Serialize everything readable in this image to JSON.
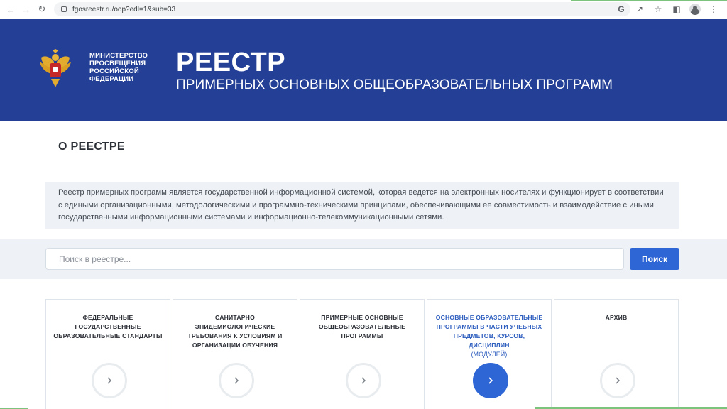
{
  "browser": {
    "url": "fgosreestr.ru/oop?edl=1&sub=33"
  },
  "header": {
    "ministry_lines": [
      "МИНИСТЕРСТВО",
      "ПРОСВЕЩЕНИЯ",
      "РОССИЙСКОЙ",
      "ФЕДЕРАЦИИ"
    ],
    "title": "РЕЕСТР",
    "subtitle": "ПРИМЕРНЫХ ОСНОВНЫХ ОБЩЕОБРАЗОВАТЕЛЬНЫХ ПРОГРАММ"
  },
  "about": {
    "title": "О РЕЕСТРЕ",
    "text": "Реестр примерных программ является государственной информационной системой, которая ведется на электронных носителях и функционирует в соответствии с едиными организационными, методологическими и программно-техническими принципами, обеспечивающими ее совместимость и взаимодействие с иными государственными информационными системами и информационно-телекоммуникационными сетями."
  },
  "search": {
    "placeholder": "Поиск в реестре...",
    "button_label": "Поиск"
  },
  "cards": [
    {
      "title": "ФЕДЕРАЛЬНЫЕ ГОСУДАРСТВЕННЫЕ ОБРАЗОВАТЕЛЬНЫЕ СТАНДАРТЫ",
      "sub": ""
    },
    {
      "title": "САНИТАРНО ЭПИДЕМИОЛОГИЧЕСКИЕ ТРЕБОВАНИЯ К УСЛОВИЯМ И ОРГАНИЗАЦИИ ОБУЧЕНИЯ",
      "sub": ""
    },
    {
      "title": "ПРИМЕРНЫЕ ОСНОВНЫЕ ОБЩЕОБРАЗОВАТЕЛЬНЫЕ ПРОГРАММЫ",
      "sub": ""
    },
    {
      "title": "ОСНОВНЫЕ ОБРАЗОВАТЕЛЬНЫЕ ПРОГРАММЫ В ЧАСТИ УЧЕБНЫХ ПРЕДМЕТОВ, КУРСОВ, ДИСЦИПЛИН",
      "sub": "(МОДУЛЕЙ)"
    },
    {
      "title": "АРХИВ",
      "sub": ""
    }
  ],
  "colors": {
    "header_bg": "#233f96",
    "accent": "#2f66d6",
    "light_bg": "#eef2f6"
  }
}
